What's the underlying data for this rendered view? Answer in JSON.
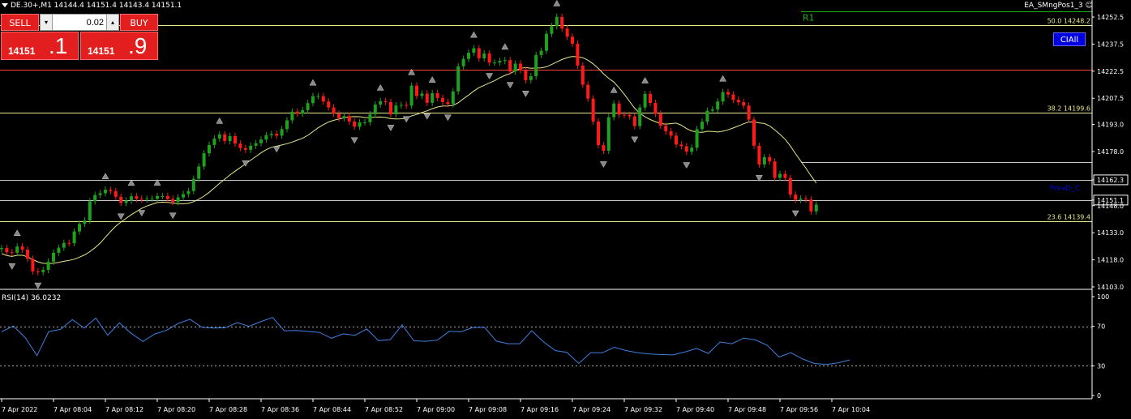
{
  "header": {
    "symbol_info": "DE.30+,M1  14144.4 14151.4 14143.4 14151.1",
    "ea_label": "EA_SMngPos1_3 ☺",
    "ciall_button": "CIAll"
  },
  "trade_panel": {
    "sell_label": "SELL",
    "buy_label": "BUY",
    "lot_value": "0.02",
    "lot_down": "▾",
    "lot_up": "▴",
    "sell_small": "14151",
    "sell_big": ".1",
    "buy_small": "14151",
    "buy_big": ".9"
  },
  "colors": {
    "bull": "#1fa01f",
    "bear": "#ff1a1a",
    "ma": "#e6e68a",
    "rsi": "#3f7fdf",
    "level": "#e6e68a",
    "red_level": "#ff4040",
    "r1": "#19b319",
    "axis_text": "#ffffff"
  },
  "chart_data": [
    {
      "type": "candlestick",
      "price_axis": [
        "14252.5",
        "14237.5",
        "14222.5",
        "14207.5",
        "14193.0",
        "14178.0",
        "14162.3",
        "14151.1",
        "14148.0",
        "14133.0",
        "14118.0",
        "14103.0"
      ],
      "ylim": [
        14103,
        14252.5
      ],
      "time_axis": [
        "7 Apr 2022",
        "7 Apr 08:04",
        "7 Apr 08:12",
        "7 Apr 08:20",
        "7 Apr 08:28",
        "7 Apr 08:36",
        "7 Apr 08:44",
        "7 Apr 08:52",
        "7 Apr 09:00",
        "7 Apr 09:08",
        "7 Apr 09:16",
        "7 Apr 09:24",
        "7 Apr 09:32",
        "7 Apr 09:40",
        "7 Apr 09:48",
        "7 Apr 09:56",
        "7 Apr 10:04"
      ],
      "levels": [
        {
          "label": "50.0 14248.2",
          "value": 14248.2
        },
        {
          "label": "38.2 14199.6",
          "value": 14199.6
        },
        {
          "label": "23.6 14139.4",
          "value": 14139.4
        },
        {
          "label": "",
          "value": 14223.5
        },
        {
          "label": "",
          "value": 14162.3
        },
        {
          "label": "",
          "value": 14151.1
        }
      ],
      "r1_label": "R1",
      "r1_value": 14255.5,
      "prevd_label": "PrevD_C",
      "current_price": "14151.1",
      "close_values": [
        14124.5,
        14122.2,
        14121.9,
        14125.4,
        14123.6,
        14118.6,
        14111.6,
        14111.2,
        14112.4,
        14117.0,
        14121.9,
        14124.7,
        14127.4,
        14127.2,
        14133.7,
        14137.9,
        14139.8,
        14150.4,
        14153.9,
        14154.9,
        14156.8,
        14156.1,
        14152.9,
        14149.5,
        14150.8,
        14153.2,
        14151.8,
        14151.4,
        14151.8,
        14151.8,
        14153.3,
        14153.3,
        14151.7,
        14150.0,
        14152.6,
        14154.4,
        14156.1,
        14162.9,
        14169.7,
        14177.0,
        14181.6,
        14185.2,
        14187.5,
        14183.8,
        14186.5,
        14182.4,
        14179.9,
        14178.9,
        14181.2,
        14182.6,
        14184.6,
        14187.1,
        14187.8,
        14186.8,
        14190.4,
        14195.3,
        14200.1,
        14198.9,
        14200.9,
        14204.8,
        14208.7,
        14208.7,
        14205.7,
        14202.4,
        14198.9,
        14196.5,
        14197.6,
        14194.6,
        14191.7,
        14194.2,
        14194.2,
        14198.6,
        14204.0,
        14205.9,
        14205.4,
        14198.6,
        14203.5,
        14203.8,
        14203.4,
        14214.5,
        14208.8,
        14210.1,
        14205.0,
        14210.3,
        14207.7,
        14205.4,
        14204.3,
        14211.3,
        14225.2,
        14229.3,
        14232.7,
        14235.2,
        14229.6,
        14232.3,
        14227.3,
        14227.3,
        14228.2,
        14228.6,
        14222.3,
        14226.7,
        14223.0,
        14217.5,
        14219.7,
        14231.5,
        14233.8,
        14243.2,
        14247.4,
        14252.6,
        14246.1,
        14241.6,
        14237.7,
        14225.6,
        14215.0,
        14207.3,
        14194.6,
        14181.5,
        14178.4,
        14197.0,
        14204.6,
        14198.4,
        14198.3,
        14197.5,
        14192.1,
        14202.4,
        14209.9,
        14204.9,
        14198.9,
        14192.3,
        14189.2,
        14186.8,
        14181.9,
        14180.9,
        14177.9,
        14180.1,
        14190.4,
        14194.5,
        14200.6,
        14201.3,
        14205.7,
        14210.9,
        14209.6,
        14206.6,
        14205.3,
        14203.4,
        14195.7,
        14181.2,
        14170.8,
        14174.9,
        14172.5,
        14163.4,
        14165.6,
        14163.3,
        14154.1,
        14151.2,
        14151.9,
        14151.4,
        14144.8,
        14148.6
      ]
    },
    {
      "type": "line",
      "title": "RSI(14) 36.0232",
      "ylim": [
        0,
        100
      ],
      "levels": [
        70,
        30
      ],
      "axis_labels": [
        "100",
        "70",
        "30",
        "0"
      ],
      "x": [
        0,
        2,
        4,
        6,
        8,
        10,
        12,
        14,
        16,
        18,
        20,
        22,
        24,
        26,
        28,
        30,
        32,
        34,
        36,
        38,
        40,
        42,
        44,
        46,
        48,
        50,
        52,
        54,
        56,
        58,
        60,
        62,
        64,
        66,
        68,
        70,
        72,
        74,
        76,
        78,
        80,
        82,
        84,
        86,
        88,
        90,
        92,
        94,
        96,
        98,
        100,
        102,
        104,
        106,
        108,
        110,
        112,
        114,
        116,
        118,
        120,
        122,
        124,
        126,
        128,
        130,
        132,
        134,
        136,
        138,
        140,
        142,
        144,
        146,
        148,
        150,
        152,
        154,
        156,
        158,
        160,
        162,
        164,
        166,
        168,
        170
      ],
      "values": [
        64.5,
        70.3,
        58.5,
        40.3,
        64.7,
        66.9,
        76.7,
        68.2,
        78.3,
        61.0,
        73.4,
        62.9,
        54.7,
        62.2,
        65.9,
        72.9,
        77.1,
        68.9,
        68.3,
        68.5,
        73.8,
        70.0,
        74.7,
        78.9,
        65.5,
        65.7,
        64.8,
        63.8,
        57.9,
        62.4,
        60.9,
        67.3,
        55.5,
        56.5,
        71.5,
        55.3,
        54.8,
        56.0,
        64.9,
        64.4,
        68.8,
        68.9,
        55.0,
        52.4,
        52.4,
        65.5,
        54.3,
        45.5,
        43.5,
        32.4,
        43.3,
        43.2,
        48.8,
        45.5,
        43.2,
        42.0,
        41.4,
        41.1,
        43.9,
        47.6,
        42.5,
        54.1,
        52.4,
        58.1,
        56.2,
        50.8,
        38.9,
        43.3,
        37.0,
        32.4,
        31.4,
        33.0,
        36.0
      ]
    }
  ]
}
